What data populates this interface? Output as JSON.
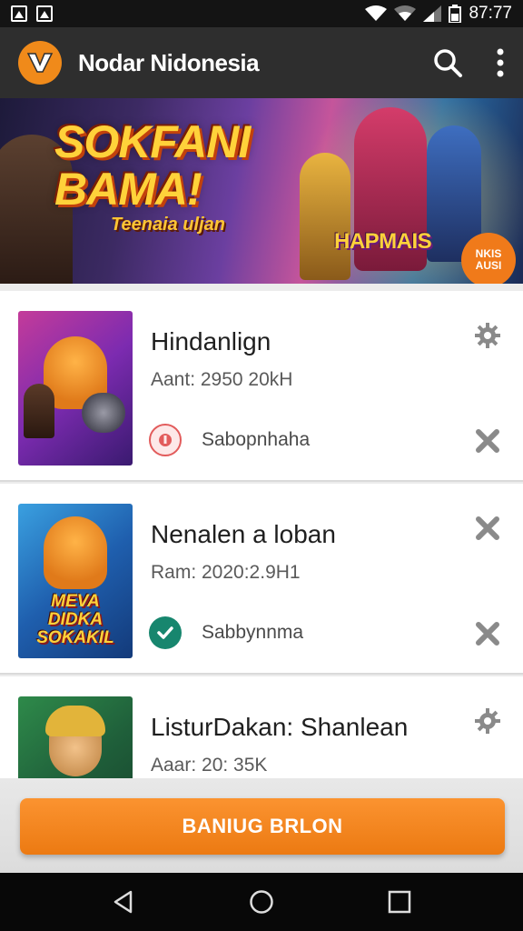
{
  "status_bar": {
    "time": "87:77"
  },
  "app_bar": {
    "title": "Nodar Nidonesia"
  },
  "banner": {
    "title_line1": "SOKFANI",
    "title_line2": "BAMA!",
    "tagline": "Teenaia uljan",
    "logo_text": "HAPMAIS",
    "badge_text": "NKIS AUSI"
  },
  "items": [
    {
      "title": "Hindanlign",
      "meta": "Aant: 2950 20kH",
      "status": "Sabopnhaha",
      "status_type": "error",
      "thumb_text": ""
    },
    {
      "title": "Nenalen a loban",
      "meta": "Ram: 2020:2.9H1",
      "status": "Sabbynnma",
      "status_type": "ok",
      "thumb_text": "MEVA DIDKA SOKAKIL"
    },
    {
      "title": "ListurDakan: Shanlean",
      "meta": "Aaar: 20: 35K",
      "status": "",
      "status_type": "",
      "thumb_text": ""
    }
  ],
  "cta": {
    "label": "BANIUG BRLON"
  },
  "colors": {
    "accent": "#f0861b",
    "appbar": "#2e2e2e",
    "error": "#e25b5b",
    "ok": "#17866e"
  }
}
